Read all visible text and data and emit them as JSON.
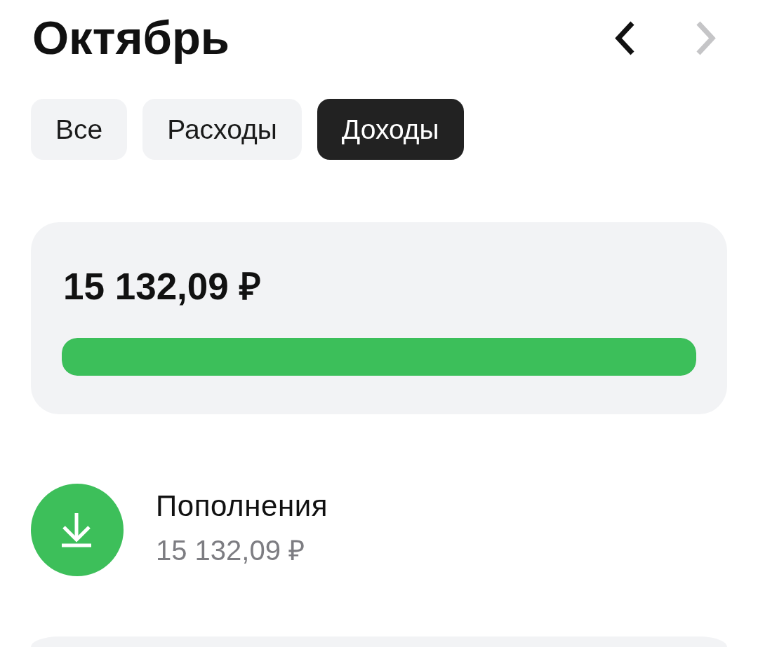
{
  "header": {
    "title": "Октябрь",
    "nav": [
      {
        "kind": "prev",
        "disabled": false
      },
      {
        "kind": "next",
        "disabled": true
      }
    ]
  },
  "tabs": [
    {
      "label": "Все",
      "selected": false
    },
    {
      "label": "Расходы",
      "selected": false
    },
    {
      "label": "Доходы",
      "selected": true
    }
  ],
  "summary": {
    "amount": "15 132,09 ₽",
    "level": 1
  },
  "categories": [
    {
      "name": "Пополнения",
      "amount": "15 132,09 ₽",
      "color": "#3dbf5a"
    }
  ]
}
